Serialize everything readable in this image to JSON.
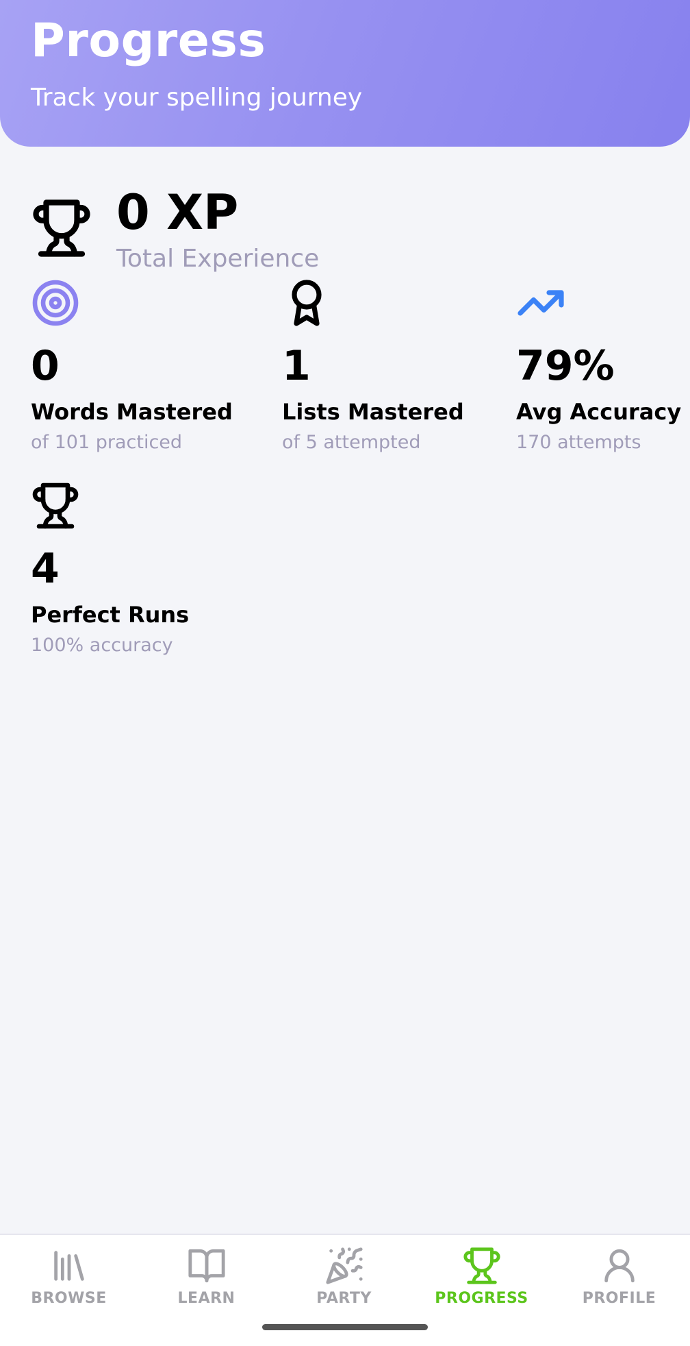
{
  "header": {
    "title": "Progress",
    "subtitle": "Track your spelling journey",
    "gradient_start": "#a7a2f4",
    "gradient_end": "#8781ee"
  },
  "xp": {
    "value": "0 XP",
    "label": "Total Experience",
    "icon": "trophy-icon"
  },
  "stats": [
    {
      "icon": "target-icon",
      "icon_color": "#8b82f0",
      "value": "0",
      "title": "Words Mastered",
      "subtitle": "of 101 practiced"
    },
    {
      "icon": "award-ribbon-icon",
      "icon_color": "#000000",
      "value": "1",
      "title": "Lists Mastered",
      "subtitle": "of 5 attempted"
    },
    {
      "icon": "trending-up-icon",
      "icon_color": "#3b82f6",
      "value": "79%",
      "title": "Avg Accuracy",
      "subtitle": "170 attempts"
    },
    {
      "icon": "trophy-icon",
      "icon_color": "#000000",
      "value": "4",
      "title": "Perfect Runs",
      "subtitle": "100% accuracy"
    }
  ],
  "tabbar": {
    "active_color": "#5cc51c",
    "inactive_color": "#a3a3a8",
    "items": [
      {
        "label": "BROWSE",
        "icon": "library-icon",
        "active": false
      },
      {
        "label": "LEARN",
        "icon": "book-open-icon",
        "active": false
      },
      {
        "label": "PARTY",
        "icon": "party-popper-icon",
        "active": false
      },
      {
        "label": "PROGRESS",
        "icon": "trophy-icon",
        "active": true
      },
      {
        "label": "PROFILE",
        "icon": "user-icon",
        "active": false
      }
    ]
  }
}
